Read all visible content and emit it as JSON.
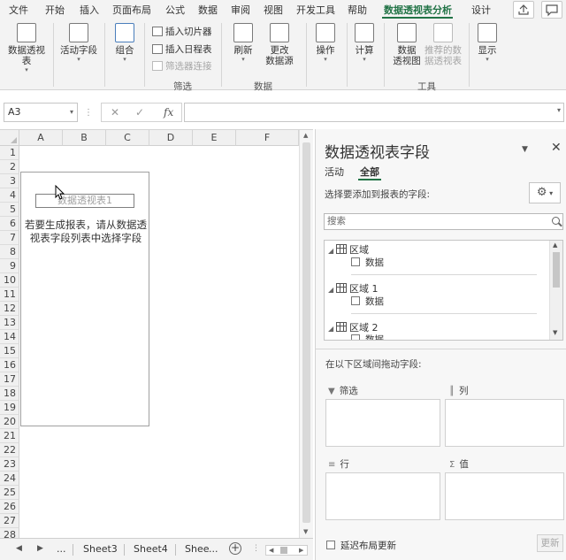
{
  "ribbon_tabs": [
    "文件",
    "开始",
    "插入",
    "页面布局",
    "公式",
    "数据",
    "审阅",
    "视图",
    "开发工具",
    "帮助",
    "数据透视表分析",
    "设计"
  ],
  "active_tab": "数据透视表分析",
  "ribbon": {
    "pivot_table": "数据透视表",
    "active_field": "活动字段",
    "group": "组合",
    "insert_slicer": "插入切片器",
    "insert_timeline": "插入日程表",
    "filter_connections": "筛选器连接",
    "filter_group_label": "筛选",
    "refresh": "刷新",
    "change_source_line1": "更改",
    "change_source_line2": "数据源",
    "data_group_label": "数据",
    "actions": "操作",
    "calculations": "计算",
    "pivot_chart_line1": "数据",
    "pivot_chart_line2": "透视图",
    "recommended_line1": "推荐的数",
    "recommended_line2": "据透视表",
    "tools_group_label": "工具",
    "show": "显示"
  },
  "formula_bar": {
    "name_box": "A3",
    "cancel": "✕",
    "enter": "✓",
    "fx": "fx",
    "formula": ""
  },
  "grid": {
    "columns": [
      "A",
      "B",
      "C",
      "D",
      "E",
      "F"
    ],
    "rows": [
      "1",
      "2",
      "3",
      "4",
      "5",
      "6",
      "7",
      "8",
      "9",
      "10",
      "11",
      "12",
      "13",
      "14",
      "15",
      "16",
      "17",
      "18",
      "19",
      "20",
      "21",
      "22",
      "23",
      "24",
      "25",
      "26",
      "27",
      "28"
    ],
    "pivot_title": "数据透视表1",
    "pivot_message": "若要生成报表，请从数据透视表字段列表中选择字段"
  },
  "sheet_tabs": {
    "ellipsis": "...",
    "tabs": [
      "Sheet3",
      "Sheet4",
      "Shee"
    ],
    "more": "..."
  },
  "pane": {
    "title": "数据透视表字段",
    "tab_active": "活动",
    "tab_all": "全部",
    "choose_label": "选择要添加到报表的字段:",
    "search_placeholder": "搜索",
    "tables": [
      {
        "name": "区域",
        "fields": [
          "数据"
        ]
      },
      {
        "name": "区域 1",
        "fields": [
          "数据"
        ]
      },
      {
        "name": "区域 2",
        "fields": [
          "数据"
        ]
      }
    ],
    "drag_label": "在以下区域间拖动字段:",
    "areas": {
      "filters": "筛选",
      "columns": "列",
      "rows": "行",
      "values": "值"
    },
    "defer_label": "延迟布局更新",
    "update_button": "更新"
  },
  "colors": {
    "accent": "#217346"
  }
}
